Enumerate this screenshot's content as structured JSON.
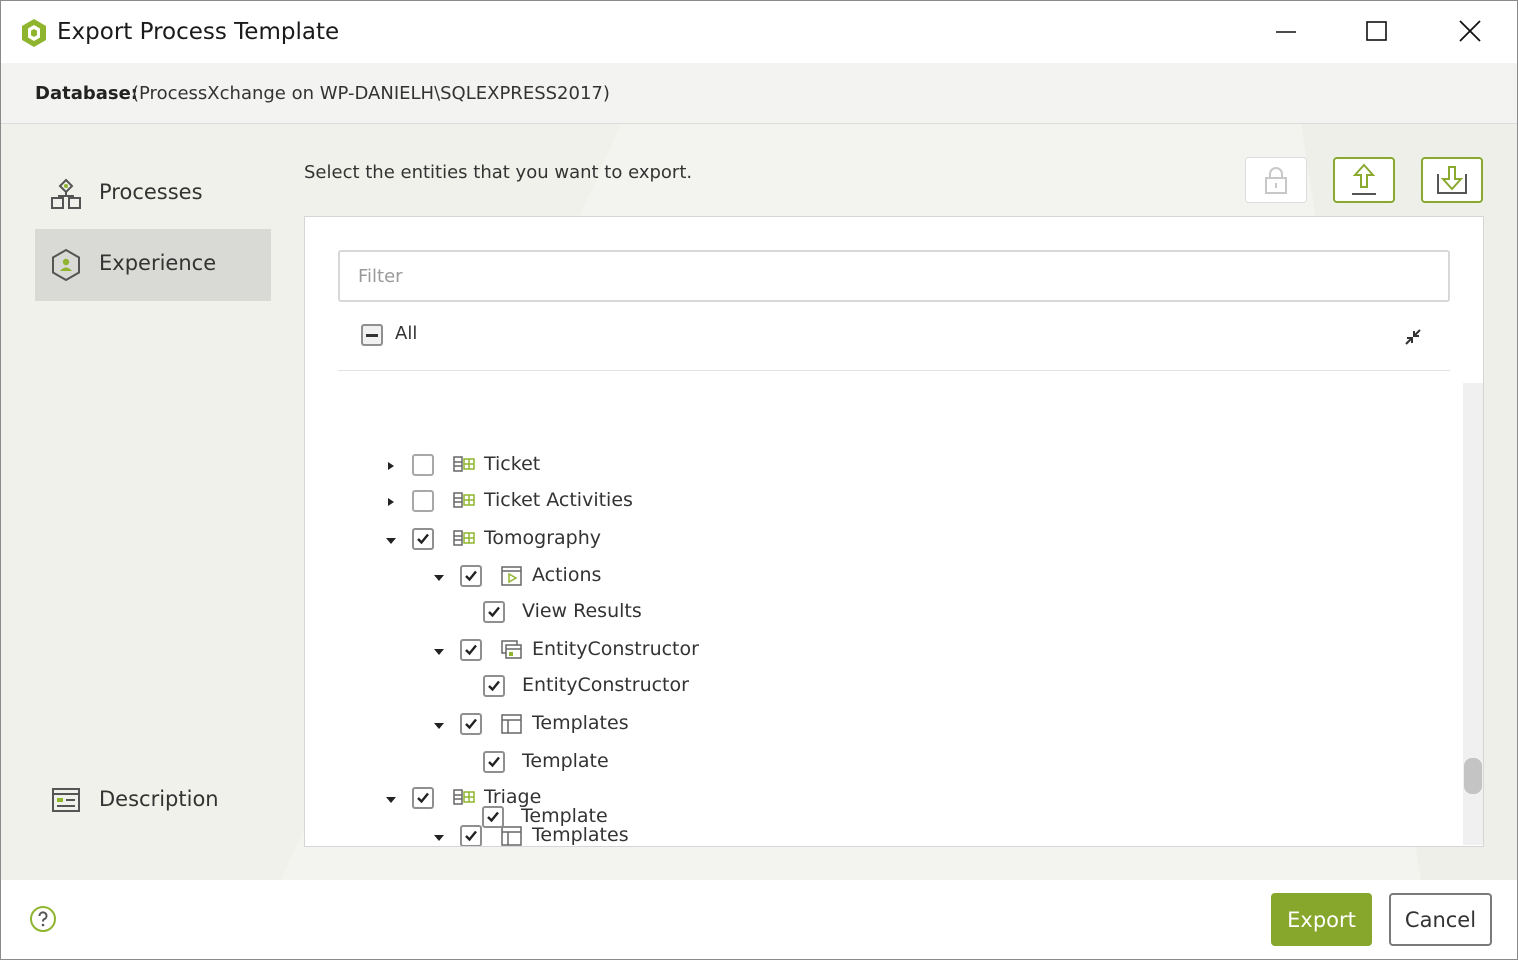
{
  "window": {
    "title": "Export Process Template",
    "controls": [
      "minimize-icon",
      "maximize-icon",
      "close-icon"
    ]
  },
  "database": {
    "label": "Database:",
    "value": "(ProcessXchange on WP-DANIELH\\SQLEXPRESS2017)"
  },
  "nav": {
    "items": [
      {
        "label": "Processes",
        "icon": "processes-icon",
        "selected": false
      },
      {
        "label": "Experience",
        "icon": "experience-icon",
        "selected": true
      }
    ],
    "description": {
      "label": "Description",
      "icon": "description-icon"
    }
  },
  "content": {
    "instructions": "Select the entities that you want to export.",
    "toolbar": [
      "lock-icon",
      "upload-icon",
      "download-icon"
    ],
    "filter_placeholder": "Filter",
    "all_label": "All",
    "all_state": "indeterminate"
  },
  "tree": [
    {
      "label": "Ticket",
      "level": 0,
      "expanded": false,
      "checked": false,
      "icon": "entity-icon"
    },
    {
      "label": "Ticket Activities",
      "level": 0,
      "expanded": false,
      "checked": false,
      "icon": "entity-icon"
    },
    {
      "label": "Tomography",
      "level": 0,
      "expanded": true,
      "checked": true,
      "icon": "entity-icon"
    },
    {
      "label": "Actions",
      "level": 1,
      "expanded": true,
      "checked": true,
      "icon": "actions-icon"
    },
    {
      "label": "View Results",
      "level": 2,
      "checked": true
    },
    {
      "label": "EntityConstructor",
      "level": 1,
      "expanded": true,
      "checked": true,
      "icon": "entity-constructor-icon"
    },
    {
      "label": "EntityConstructor",
      "level": 2,
      "checked": true
    },
    {
      "label": "Templates",
      "level": 1,
      "expanded": true,
      "checked": true,
      "icon": "templates-icon"
    },
    {
      "label": "Template",
      "level": 2,
      "checked": true
    },
    {
      "label": "Triage",
      "level": 0,
      "expanded": true,
      "checked": true,
      "icon": "entity-icon"
    },
    {
      "label": "Templates",
      "level": 1,
      "expanded": true,
      "checked": true,
      "icon": "templates-icon"
    },
    {
      "label": "Template",
      "level": 2,
      "checked": true
    }
  ],
  "footer": {
    "export_label": "Export",
    "cancel_label": "Cancel",
    "help_icon": "help-icon"
  },
  "colors": {
    "accent": "#86a62c",
    "nav_selected": "#d9dad6",
    "background": "#f3f4ef"
  }
}
